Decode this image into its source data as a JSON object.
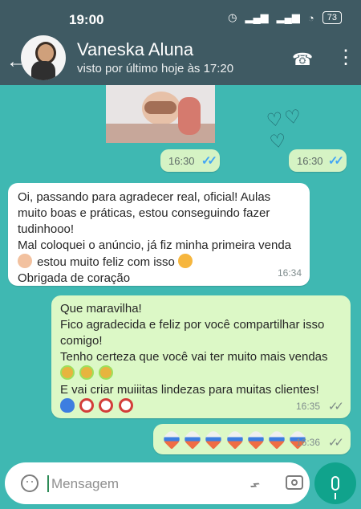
{
  "status_bar": {
    "time": "19:00",
    "battery": "73"
  },
  "header": {
    "contact_name": "Vaneska Aluna",
    "last_seen": "visto por último hoje às 17:20",
    "icons": [
      "back-arrow-icon",
      "avatar",
      "phone-icon",
      "more-vert-icon"
    ]
  },
  "chat": {
    "messages": [
      {
        "type": "image",
        "time": "16:30",
        "status": "read"
      },
      {
        "type": "sticker",
        "time": "16:30",
        "status": "read"
      },
      {
        "type": "incoming",
        "lines": [
          "Oi, passando para agradecer real, oficial! Aulas",
          "muito boas e práticas, estou conseguindo fazer",
          "tudinhooo!",
          "Mal coloquei o anúncio, já fiz minha primeira venda",
          "estou muito feliz com isso",
          "Obrigada de coração"
        ],
        "time": "16:34"
      },
      {
        "type": "outgoing",
        "lines": [
          "Que maravilha!",
          "Fico agradecida e feliz por você compartilhar isso",
          "comigo!",
          "Tenho certeza que você vai ter muito mais vendas",
          "E vai criar muiiitas lindezas para muitas clientes!"
        ],
        "time": "16:35",
        "status": "delivered"
      },
      {
        "type": "outgoing",
        "time": "16:36",
        "status": "delivered"
      }
    ]
  },
  "input": {
    "placeholder": "Mensagem",
    "icons": [
      "emoji-icon",
      "attachment-icon",
      "camera-icon",
      "microphone-icon"
    ]
  },
  "colors": {
    "header": "#3f5a63",
    "chat_background": "#3fb8b2",
    "incoming_bubble": "#ffffff",
    "outgoing_bubble": "#dcf8c6",
    "read_ticks": "#42a5f5",
    "mic_button": "#10a38c"
  }
}
